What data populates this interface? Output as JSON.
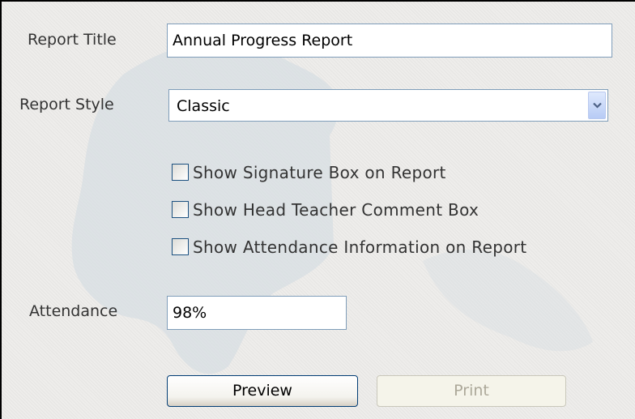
{
  "report_title": {
    "label": "Report Title",
    "value": "Annual Progress Report"
  },
  "report_style": {
    "label": "Report Style",
    "selected": "Classic",
    "arrow_icon": "chevron-down-icon"
  },
  "options": [
    {
      "label": "Show Signature Box on Report",
      "checked": false
    },
    {
      "label": "Show Head Teacher Comment Box",
      "checked": false
    },
    {
      "label": "Show Attendance Information on Report",
      "checked": false
    }
  ],
  "attendance": {
    "label": "Attendance",
    "value": "98%"
  },
  "buttons": {
    "preview": "Preview",
    "print": "Print",
    "print_enabled": false
  },
  "colors": {
    "field_border": "#7f9db9",
    "checkbox_border": "#1c5180",
    "preview_border": "#003c74",
    "disabled_text": "#aca899",
    "background": "#eeedeb",
    "map_shape": "#d7dee3"
  }
}
